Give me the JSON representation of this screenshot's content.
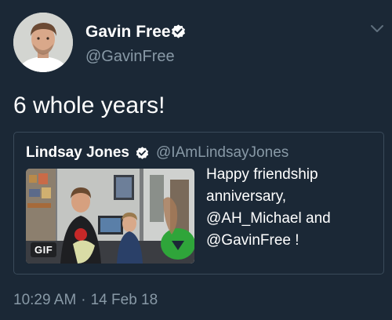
{
  "author": {
    "display_name": "Gavin Free",
    "handle": "@GavinFree",
    "verified": true
  },
  "tweet": {
    "text": "6 whole years!"
  },
  "quoted_tweet": {
    "display_name": "Lindsay Jones",
    "handle": "@IAmLindsayJones",
    "verified": true,
    "media_badge": "GIF",
    "text_lines": [
      "Happy friendship",
      "anniversary,",
      "@AH_Michael and",
      "@GavinFree !"
    ]
  },
  "meta": {
    "time": "10:29 AM",
    "separator": "·",
    "date": "14 Feb 18"
  },
  "icons": {
    "verified": "verified-badge-icon",
    "menu": "chevron-down-icon"
  },
  "colors": {
    "background": "#1b2836",
    "secondary_text": "#8899a6",
    "border": "#3a4a5a"
  }
}
